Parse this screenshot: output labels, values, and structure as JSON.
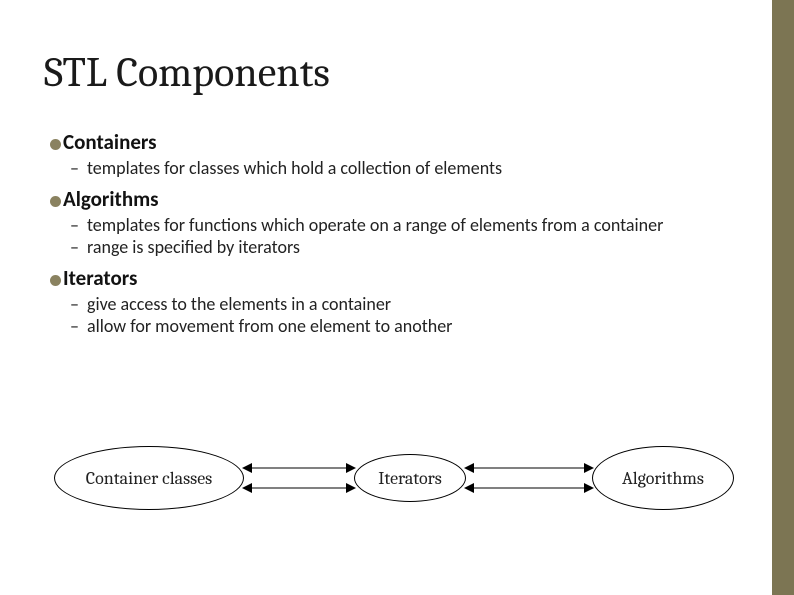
{
  "title": "STL Components",
  "sections": [
    {
      "heading": "Containers",
      "items": [
        "templates for classes which hold a collection of elements"
      ]
    },
    {
      "heading": "Algorithms",
      "items": [
        "templates for functions which operate on a range of elements from a container",
        "range is specified by iterators"
      ]
    },
    {
      "heading": "Iterators",
      "items": [
        "give access to the elements in a container",
        "allow for movement from one element to another"
      ]
    }
  ],
  "diagram": {
    "nodes": [
      "Container classes",
      "Iterators",
      "Algorithms"
    ]
  }
}
